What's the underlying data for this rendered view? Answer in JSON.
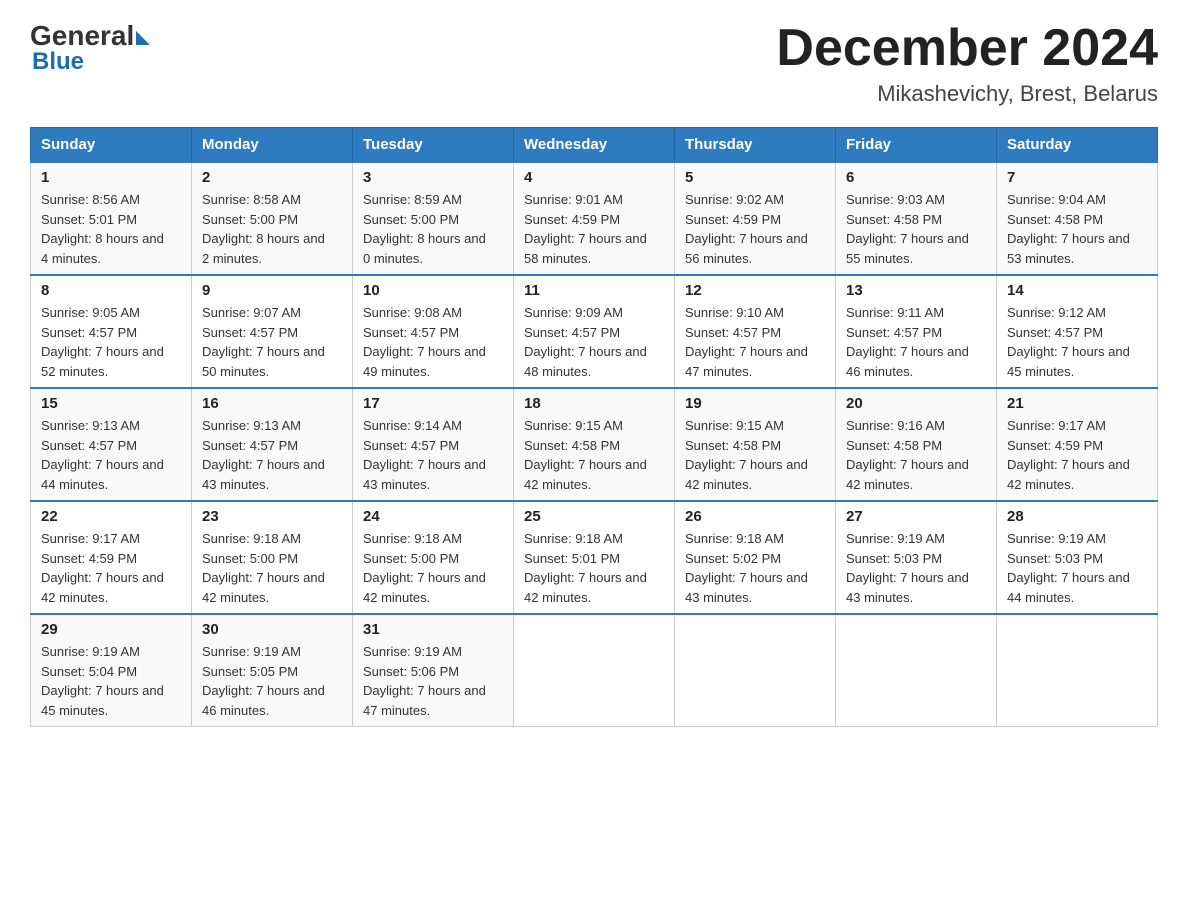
{
  "header": {
    "logo_general": "General",
    "logo_blue": "Blue",
    "month_year": "December 2024",
    "location": "Mikashevichy, Brest, Belarus"
  },
  "days_of_week": [
    "Sunday",
    "Monday",
    "Tuesday",
    "Wednesday",
    "Thursday",
    "Friday",
    "Saturday"
  ],
  "weeks": [
    [
      {
        "num": "1",
        "sunrise": "8:56 AM",
        "sunset": "5:01 PM",
        "daylight": "8 hours and 4 minutes."
      },
      {
        "num": "2",
        "sunrise": "8:58 AM",
        "sunset": "5:00 PM",
        "daylight": "8 hours and 2 minutes."
      },
      {
        "num": "3",
        "sunrise": "8:59 AM",
        "sunset": "5:00 PM",
        "daylight": "8 hours and 0 minutes."
      },
      {
        "num": "4",
        "sunrise": "9:01 AM",
        "sunset": "4:59 PM",
        "daylight": "7 hours and 58 minutes."
      },
      {
        "num": "5",
        "sunrise": "9:02 AM",
        "sunset": "4:59 PM",
        "daylight": "7 hours and 56 minutes."
      },
      {
        "num": "6",
        "sunrise": "9:03 AM",
        "sunset": "4:58 PM",
        "daylight": "7 hours and 55 minutes."
      },
      {
        "num": "7",
        "sunrise": "9:04 AM",
        "sunset": "4:58 PM",
        "daylight": "7 hours and 53 minutes."
      }
    ],
    [
      {
        "num": "8",
        "sunrise": "9:05 AM",
        "sunset": "4:57 PM",
        "daylight": "7 hours and 52 minutes."
      },
      {
        "num": "9",
        "sunrise": "9:07 AM",
        "sunset": "4:57 PM",
        "daylight": "7 hours and 50 minutes."
      },
      {
        "num": "10",
        "sunrise": "9:08 AM",
        "sunset": "4:57 PM",
        "daylight": "7 hours and 49 minutes."
      },
      {
        "num": "11",
        "sunrise": "9:09 AM",
        "sunset": "4:57 PM",
        "daylight": "7 hours and 48 minutes."
      },
      {
        "num": "12",
        "sunrise": "9:10 AM",
        "sunset": "4:57 PM",
        "daylight": "7 hours and 47 minutes."
      },
      {
        "num": "13",
        "sunrise": "9:11 AM",
        "sunset": "4:57 PM",
        "daylight": "7 hours and 46 minutes."
      },
      {
        "num": "14",
        "sunrise": "9:12 AM",
        "sunset": "4:57 PM",
        "daylight": "7 hours and 45 minutes."
      }
    ],
    [
      {
        "num": "15",
        "sunrise": "9:13 AM",
        "sunset": "4:57 PM",
        "daylight": "7 hours and 44 minutes."
      },
      {
        "num": "16",
        "sunrise": "9:13 AM",
        "sunset": "4:57 PM",
        "daylight": "7 hours and 43 minutes."
      },
      {
        "num": "17",
        "sunrise": "9:14 AM",
        "sunset": "4:57 PM",
        "daylight": "7 hours and 43 minutes."
      },
      {
        "num": "18",
        "sunrise": "9:15 AM",
        "sunset": "4:58 PM",
        "daylight": "7 hours and 42 minutes."
      },
      {
        "num": "19",
        "sunrise": "9:15 AM",
        "sunset": "4:58 PM",
        "daylight": "7 hours and 42 minutes."
      },
      {
        "num": "20",
        "sunrise": "9:16 AM",
        "sunset": "4:58 PM",
        "daylight": "7 hours and 42 minutes."
      },
      {
        "num": "21",
        "sunrise": "9:17 AM",
        "sunset": "4:59 PM",
        "daylight": "7 hours and 42 minutes."
      }
    ],
    [
      {
        "num": "22",
        "sunrise": "9:17 AM",
        "sunset": "4:59 PM",
        "daylight": "7 hours and 42 minutes."
      },
      {
        "num": "23",
        "sunrise": "9:18 AM",
        "sunset": "5:00 PM",
        "daylight": "7 hours and 42 minutes."
      },
      {
        "num": "24",
        "sunrise": "9:18 AM",
        "sunset": "5:00 PM",
        "daylight": "7 hours and 42 minutes."
      },
      {
        "num": "25",
        "sunrise": "9:18 AM",
        "sunset": "5:01 PM",
        "daylight": "7 hours and 42 minutes."
      },
      {
        "num": "26",
        "sunrise": "9:18 AM",
        "sunset": "5:02 PM",
        "daylight": "7 hours and 43 minutes."
      },
      {
        "num": "27",
        "sunrise": "9:19 AM",
        "sunset": "5:03 PM",
        "daylight": "7 hours and 43 minutes."
      },
      {
        "num": "28",
        "sunrise": "9:19 AM",
        "sunset": "5:03 PM",
        "daylight": "7 hours and 44 minutes."
      }
    ],
    [
      {
        "num": "29",
        "sunrise": "9:19 AM",
        "sunset": "5:04 PM",
        "daylight": "7 hours and 45 minutes."
      },
      {
        "num": "30",
        "sunrise": "9:19 AM",
        "sunset": "5:05 PM",
        "daylight": "7 hours and 46 minutes."
      },
      {
        "num": "31",
        "sunrise": "9:19 AM",
        "sunset": "5:06 PM",
        "daylight": "7 hours and 47 minutes."
      },
      null,
      null,
      null,
      null
    ]
  ],
  "labels": {
    "sunrise": "Sunrise: ",
    "sunset": "Sunset: ",
    "daylight": "Daylight: "
  }
}
